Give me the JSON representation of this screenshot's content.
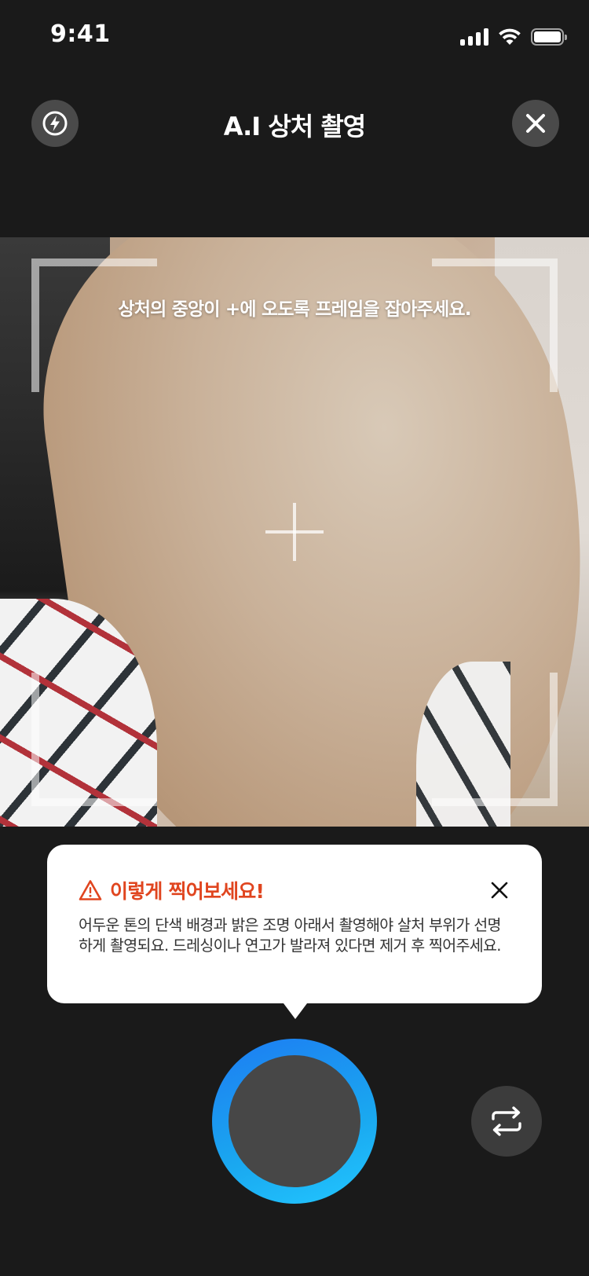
{
  "status_bar": {
    "time": "9:41"
  },
  "header": {
    "title": "A.I 상처 촬영",
    "flash_icon": "flash-icon",
    "close_icon": "close-icon"
  },
  "camera": {
    "guide_text": "상처의 중앙이 +에 오도록 프레임을 잡아주세요."
  },
  "tip": {
    "title": "이렇게 찍어보세요!",
    "body": "어두운 톤의 단색 배경과 밝은 조명 아래서 촬영해야 살처 부위가 선명하게 촬영되요. 드레싱이나 연고가 발라져 있다면 제거 후 찍어주세요.",
    "warning_color": "#e0451f"
  },
  "controls": {
    "shutter_color": "#1d7cf2",
    "switch_icon": "camera-switch-icon"
  }
}
